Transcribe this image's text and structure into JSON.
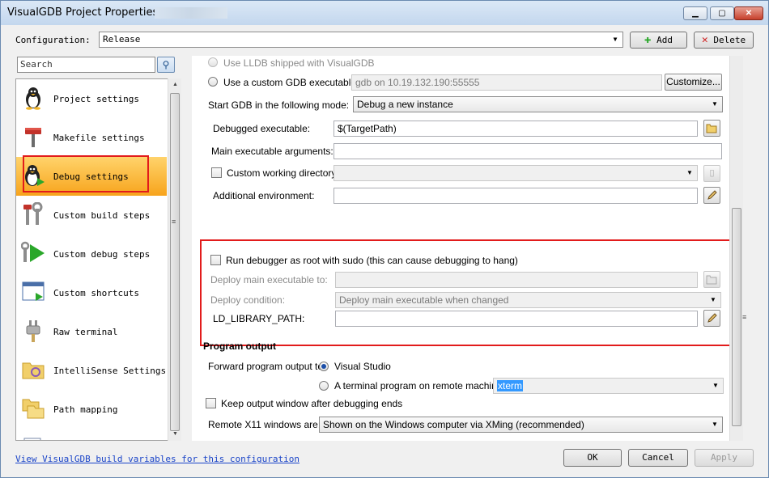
{
  "window": {
    "title": "VisualGDB Project Properties -",
    "controls": {
      "minimize": "▁",
      "maximize": "▢",
      "close": "✕"
    }
  },
  "config": {
    "label": "Configuration:",
    "value": "Release",
    "add_label": "Add",
    "delete_label": "Delete"
  },
  "search": {
    "placeholder": "Search",
    "button_icon": "⚲"
  },
  "sidebar": {
    "items": [
      {
        "label": "Project settings",
        "icon": "penguin-icon"
      },
      {
        "label": "Makefile settings",
        "icon": "hammer-icon"
      },
      {
        "label": "Debug settings",
        "icon": "penguin-debug-icon"
      },
      {
        "label": "Custom build steps",
        "icon": "tools-icon"
      },
      {
        "label": "Custom debug steps",
        "icon": "play-tools-icon"
      },
      {
        "label": "Custom shortcuts",
        "icon": "window-shortcut-icon"
      },
      {
        "label": "Raw terminal",
        "icon": "plug-icon"
      },
      {
        "label": "IntelliSense Settings",
        "icon": "folder-settings-icon"
      },
      {
        "label": "Path mapping",
        "icon": "folders-icon"
      }
    ],
    "selected": "Debug settings"
  },
  "debug": {
    "lldb_label": "Use LLDB shipped with VisualGDB",
    "custom_gdb_label": "Use a custom GDB executable:",
    "custom_gdb_value": "gdb on 10.19.132.190:55555",
    "customize_label": "Customize...",
    "start_mode_label": "Start GDB in the following mode:",
    "start_mode_value": "Debug a new instance",
    "debugged_exe_label": "Debugged executable:",
    "debugged_exe_value": "$(TargetPath)",
    "main_args_label": "Main executable arguments:",
    "main_args_value": "",
    "custom_wd_label": "Custom working directory:",
    "additional_env_label": "Additional environment:",
    "additional_env_value": "",
    "run_as_root_label": "Run debugger as root with sudo (this can cause debugging to hang)",
    "deploy_main_label": "Deploy main executable to:",
    "deploy_condition_label": "Deploy condition:",
    "deploy_condition_value": "Deploy main executable when changed",
    "ld_path_label": "LD_LIBRARY_PATH:",
    "ld_path_value": ""
  },
  "program_output": {
    "section_title": "Program output",
    "forward_label": "Forward program output to:",
    "visual_studio_label": "Visual Studio",
    "terminal_label": "A terminal program on remote machine:",
    "terminal_value": "xterm",
    "keep_window_label": "Keep output window after debugging ends",
    "x11_label": "Remote X11 windows are:",
    "x11_value": "Shown on the Windows computer via XMing (recommended)"
  },
  "footer": {
    "link_text": "View VisualGDB build variables for this configuration",
    "ok_label": "OK",
    "cancel_label": "Cancel",
    "apply_label": "Apply"
  },
  "colors": {
    "selection": "#f7a41c",
    "highlight_box": "#e21b1b",
    "link": "#1a44c8"
  }
}
